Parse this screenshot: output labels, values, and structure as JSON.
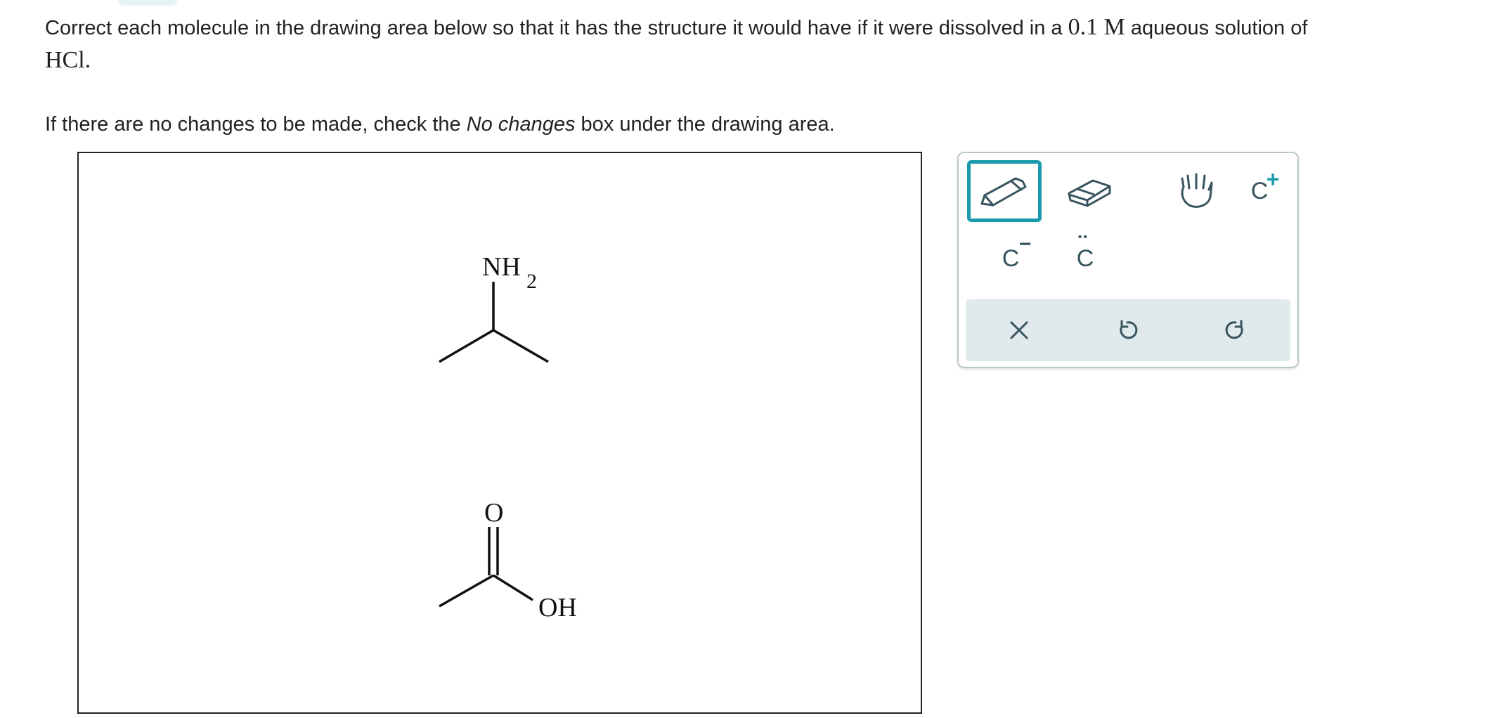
{
  "prompt": {
    "line1_a": "Correct each molecule in the drawing area below so that it has the structure it would have if it were dissolved in a ",
    "concentration": "0.1 M",
    "line1_b": " aqueous solution of",
    "acid": "HCl.",
    "line2_a": "If there are no changes to be made, check the ",
    "line2_em": "No changes",
    "line2_b": " box under the drawing area."
  },
  "molecules": {
    "amine": {
      "nh": "NH",
      "subscript": "2"
    },
    "acid": {
      "o_label": "O",
      "oh_label": "OH"
    }
  },
  "toolbar": {
    "tools": [
      {
        "name": "pencil",
        "icon": "pencil-icon",
        "selected": true
      },
      {
        "name": "eraser",
        "icon": "eraser-icon"
      },
      {
        "name": "hand",
        "icon": "hand-icon"
      },
      {
        "name": "positive-charge",
        "label": "C",
        "mark": "+"
      },
      {
        "name": "negative-charge",
        "label": "C",
        "mark": "−"
      },
      {
        "name": "lone-pair",
        "label": "C",
        "mark": "••"
      }
    ],
    "actions": [
      {
        "name": "clear",
        "icon": "close-icon"
      },
      {
        "name": "undo",
        "icon": "undo-icon"
      },
      {
        "name": "redo",
        "icon": "redo-icon"
      }
    ]
  },
  "colors": {
    "accent": "#1a9aaa",
    "icon": "#37545f",
    "positive": "#1a9aaa",
    "action_bar": "#e0e9ec"
  }
}
